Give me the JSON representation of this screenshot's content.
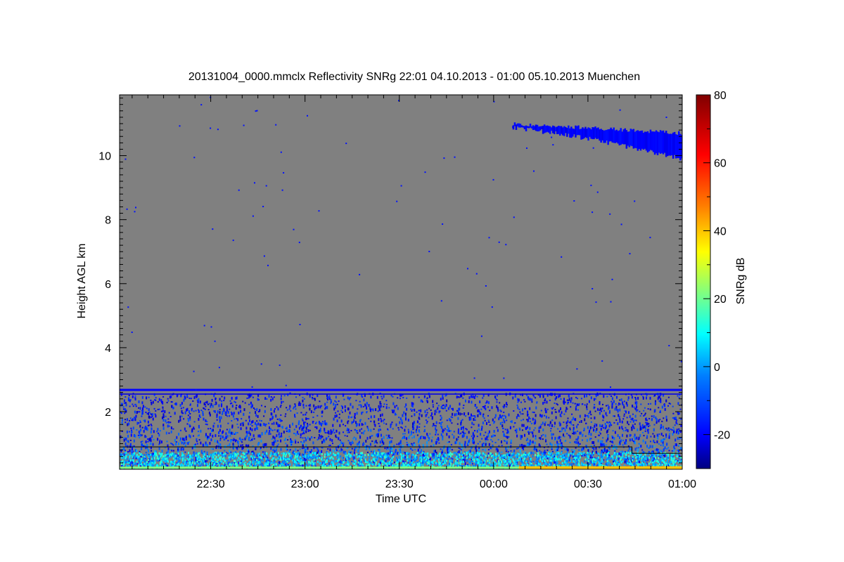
{
  "chart_data": {
    "type": "heatmap",
    "title": "20131004_0000.mmclx Reflectivity SNRg   22:01 04.10.2013 - 01:00 05.10.2013 Muenchen",
    "xlabel": "Time UTC",
    "ylabel": "Height AGL km",
    "x_ticks": [
      "22:30",
      "23:00",
      "23:30",
      "00:00",
      "00:30",
      "01:00"
    ],
    "x_tick_minutes": [
      30,
      60,
      90,
      120,
      150,
      180
    ],
    "xlim_minutes": [
      1,
      180
    ],
    "y_ticks": [
      "2",
      "4",
      "6",
      "8",
      "10"
    ],
    "y_tick_values": [
      2,
      4,
      6,
      8,
      10
    ],
    "ylim_km": [
      0.2,
      11.9
    ],
    "background_color": "#808080",
    "colorbar": {
      "label": "SNRg dB",
      "ticks": [
        "-20",
        "0",
        "20",
        "40",
        "60",
        "80"
      ],
      "tick_values": [
        -20,
        0,
        20,
        40,
        60,
        80
      ],
      "range": [
        -30,
        80
      ],
      "colormap": [
        "#000080",
        "#0000ff",
        "#0080ff",
        "#00ffff",
        "#80ff80",
        "#ffff00",
        "#ff8000",
        "#ff0000",
        "#800000"
      ]
    },
    "features": {
      "cirrus_layer": {
        "time_start_minutes": 126,
        "time_end_minutes": 180,
        "top_start_km": 11.0,
        "top_end_km": 10.7,
        "bottom_start_km": 10.85,
        "bottom_end_km": 9.9,
        "snr_db": -20
      },
      "boundary_layer_noise": {
        "top_km": 2.6,
        "snr_db_range": [
          -25,
          15
        ]
      },
      "noise_line_km": 2.68,
      "surface_strong_echo": {
        "time_start_minutes": 128,
        "time_end_minutes": 180,
        "height_km": 0.25,
        "snr_db": 40
      },
      "mixing_layer_line": {
        "height_km": 0.9,
        "step_minutes": 164,
        "height_after_step_km": 0.7
      }
    }
  }
}
